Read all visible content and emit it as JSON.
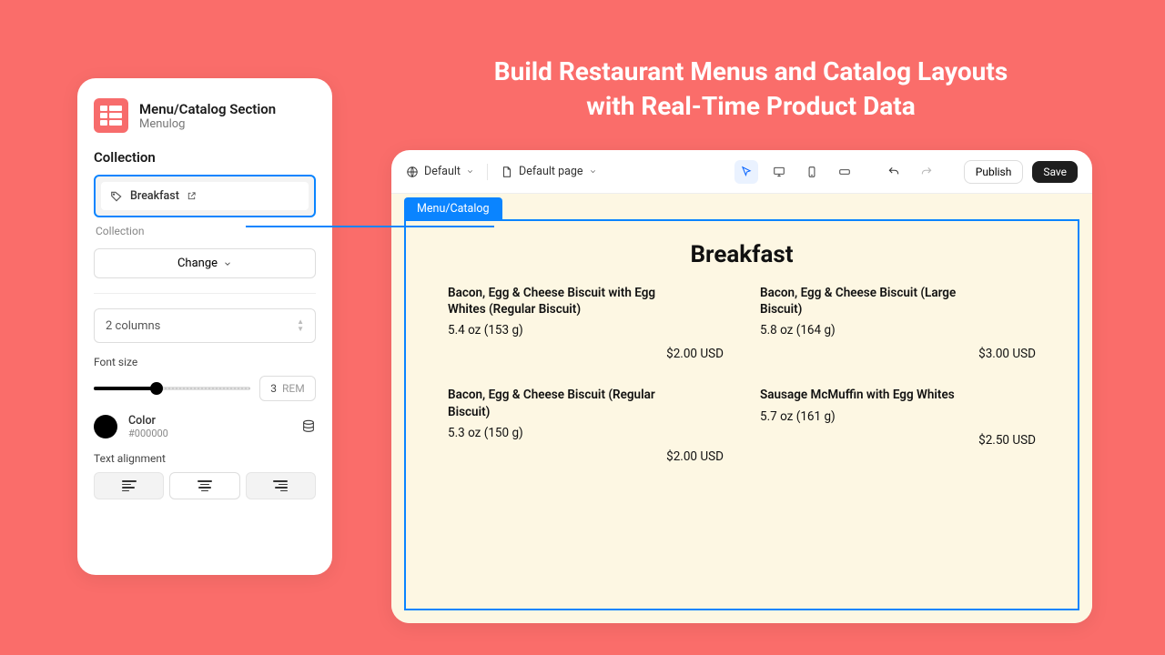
{
  "hero": {
    "line1": "Build Restaurant Menus and Catalog Layouts",
    "line2": "with Real-Time Product Data"
  },
  "settings": {
    "title": "Menu/Catalog Section",
    "subtitle": "Menulog",
    "section_label": "Collection",
    "selected_collection": "Breakfast",
    "collection_sub_label": "Collection",
    "change_label": "Change",
    "columns_label": "2 columns",
    "font_size_label": "Font size",
    "font_size_value": "3",
    "font_size_unit": "REM",
    "color_label": "Color",
    "color_hex": "#000000",
    "text_align_label": "Text alignment"
  },
  "toolbar": {
    "theme_label": "Default",
    "page_label": "Default page",
    "publish_label": "Publish",
    "save_label": "Save"
  },
  "preview": {
    "frame_tab": "Menu/Catalog",
    "title": "Breakfast",
    "items": [
      {
        "name": "Bacon, Egg & Cheese Biscuit with Egg Whites (Regular Biscuit)",
        "weight": "5.4 oz (153 g)",
        "price": "$2.00 USD"
      },
      {
        "name": "Bacon, Egg & Cheese Biscuit (Large Biscuit)",
        "weight": "5.8 oz (164 g)",
        "price": "$3.00 USD"
      },
      {
        "name": "Bacon, Egg & Cheese Biscuit (Regular Biscuit)",
        "weight": "5.3 oz (150 g)",
        "price": "$2.00 USD"
      },
      {
        "name": "Sausage McMuffin with Egg Whites",
        "weight": "5.7 oz (161 g)",
        "price": "$2.50 USD"
      }
    ]
  }
}
